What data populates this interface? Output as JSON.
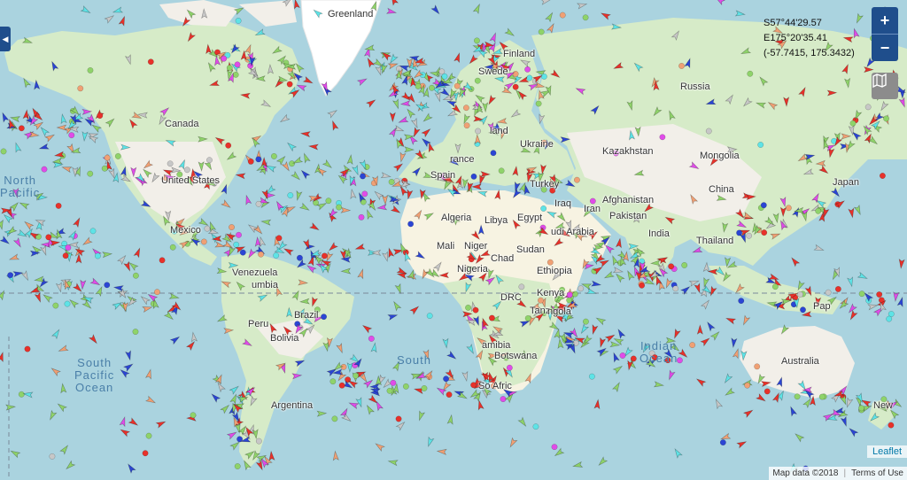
{
  "map": {
    "continent_labels": [
      {
        "id": "greenland",
        "text": "Greenland"
      },
      {
        "id": "canada",
        "text": "Canada"
      },
      {
        "id": "united-states",
        "text": "United States"
      },
      {
        "id": "mexico",
        "text": "Mexico"
      },
      {
        "id": "venezuela",
        "text": "Venezuela"
      },
      {
        "id": "colombia",
        "text": "umbia"
      },
      {
        "id": "peru",
        "text": "Peru"
      },
      {
        "id": "brazil",
        "text": "Brazil"
      },
      {
        "id": "bolivia",
        "text": "Bolivia"
      },
      {
        "id": "argentina",
        "text": "Argentina"
      },
      {
        "id": "finland",
        "text": "Finland"
      },
      {
        "id": "sweden",
        "text": "Swede"
      },
      {
        "id": "poland",
        "text": "land"
      },
      {
        "id": "france",
        "text": "rance"
      },
      {
        "id": "spain",
        "text": "Spain"
      },
      {
        "id": "ukraine",
        "text": "Ukraine"
      },
      {
        "id": "turkey",
        "text": "Turkey"
      },
      {
        "id": "russia",
        "text": "Russia"
      },
      {
        "id": "kazakhstan",
        "text": "Kazakhstan"
      },
      {
        "id": "mongolia",
        "text": "Mongolia"
      },
      {
        "id": "china",
        "text": "China"
      },
      {
        "id": "afghanistan",
        "text": "Afghanistan"
      },
      {
        "id": "pakistan",
        "text": "Pakistan"
      },
      {
        "id": "iraq",
        "text": "Iraq"
      },
      {
        "id": "iran",
        "text": "Iran"
      },
      {
        "id": "india",
        "text": "India"
      },
      {
        "id": "thailand",
        "text": "Thailand"
      },
      {
        "id": "algeria",
        "text": "Algeria"
      },
      {
        "id": "libya",
        "text": "Libya"
      },
      {
        "id": "egypt",
        "text": "Egypt"
      },
      {
        "id": "saudi-arabia",
        "text": "udi Arabia"
      },
      {
        "id": "mali",
        "text": "Mali"
      },
      {
        "id": "niger",
        "text": "Niger"
      },
      {
        "id": "sudan",
        "text": "Sudan"
      },
      {
        "id": "chad",
        "text": "Chad"
      },
      {
        "id": "nigeria",
        "text": "Nigeria"
      },
      {
        "id": "ethiopia",
        "text": "Ethiopia"
      },
      {
        "id": "drc",
        "text": "DRC"
      },
      {
        "id": "kenya",
        "text": "Kenya"
      },
      {
        "id": "tanzania",
        "text": "Tanz"
      },
      {
        "id": "angola",
        "text": "ngola"
      },
      {
        "id": "namibia",
        "text": "amibia"
      },
      {
        "id": "botswana",
        "text": "Botswana"
      },
      {
        "id": "south-africa",
        "text": "So  Afric"
      },
      {
        "id": "australia",
        "text": "Australia"
      },
      {
        "id": "new-zealand",
        "text": "New"
      },
      {
        "id": "japan",
        "text": "Japan"
      },
      {
        "id": "papua",
        "text": "Pap"
      }
    ],
    "ocean_labels": [
      {
        "id": "north-pacific",
        "text": "North\nPacific"
      },
      {
        "id": "south-pacific",
        "text": "South\nPacific\nOcean"
      },
      {
        "id": "south-atlantic",
        "text": "South"
      },
      {
        "id": "indian-ocean",
        "text": "Indian\nOcean"
      }
    ],
    "colors": {
      "water": "#aad3df",
      "land": "#f2efe9",
      "forest": "#d6ebc8",
      "desert": "#f7f3e2",
      "ice": "#ffffff",
      "cargo": "#8fd36a",
      "tanker": "#e8312a",
      "passenger": "#2b45d4",
      "tug": "#5ee3e6",
      "fishing": "#f0a074",
      "pleasure": "#e04ce8",
      "unknown": "#c7c7c7"
    },
    "legend_icons": [
      "vessel-arrow-icon",
      "stationary-vessel-dot-icon"
    ]
  },
  "controls": {
    "side_toggle": "◀",
    "coordinates": {
      "lat_dms": "S57°44'29.57",
      "lon_dms": "E175°20'35.41",
      "decimal": "(-57.7415, 175.3432)"
    },
    "zoom_in": "+",
    "zoom_out": "−",
    "layers_icon": "map-layers-icon"
  },
  "attribution": {
    "leaflet": "Leaflet",
    "map_data": "Map data ©2018",
    "terms": "Terms of Use"
  }
}
